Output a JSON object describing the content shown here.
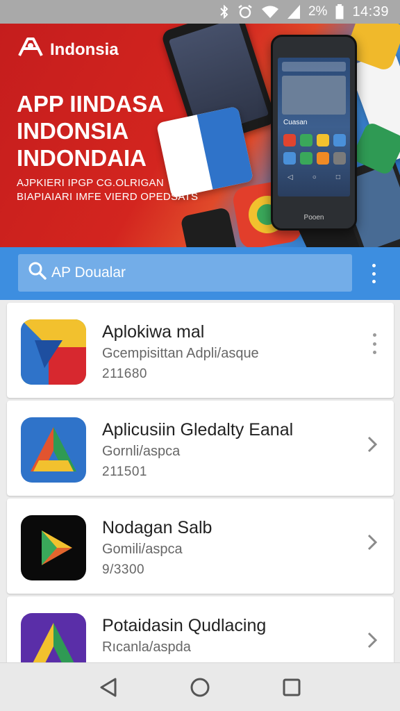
{
  "status_bar": {
    "time": "14:39",
    "battery": "2%",
    "icons": [
      "bluetooth-off-icon",
      "alarm-icon",
      "wifi-icon",
      "signal-icon",
      "battery-icon"
    ]
  },
  "banner": {
    "brand": "Indonsia",
    "headline_lines": [
      "APP IINDASA",
      "INDONSIA",
      "INDONDAIA"
    ],
    "tagline_lines": [
      "AJPKIERI IPGP CG.OLRIGAN",
      "BIAPIAIARI IMFE VIERD OPEDSATS"
    ],
    "phone_header": "Cuasan",
    "phone_brand": "Pooen"
  },
  "search": {
    "placeholder": "AP Doualar"
  },
  "apps": [
    {
      "title": "Aplokiwa mal",
      "subtitle": "Gcempisittan Adpli/asque",
      "number": "211680",
      "action": "more"
    },
    {
      "title": "Aplicusiin Gledalty Eanal",
      "subtitle": "Gornli/aspca",
      "number": "211501",
      "action": "open"
    },
    {
      "title": "Nodagan Salb",
      "subtitle": "Gomili/aspca",
      "number": "9/3300",
      "action": "open"
    },
    {
      "title": "Potaidasin Qudlacing",
      "subtitle": "Rıcanla/aspda",
      "number": "",
      "action": "open"
    }
  ],
  "colors": {
    "banner_red": "#d3251f",
    "search_strip": "#3d8ee0",
    "text_primary": "#222222",
    "text_secondary": "#666666"
  }
}
